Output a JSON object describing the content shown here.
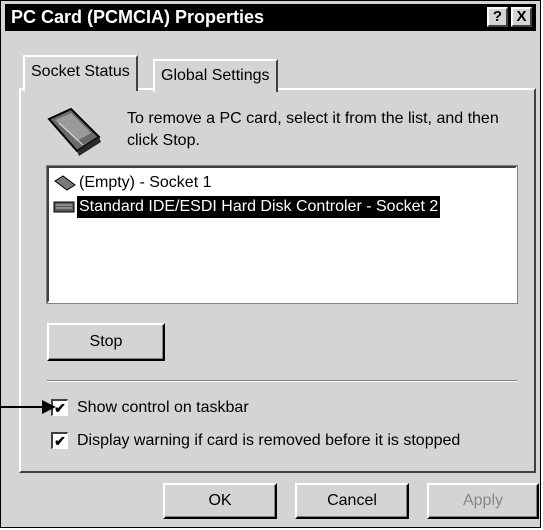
{
  "window": {
    "title": "PC Card (PCMCIA) Properties",
    "help_button": "?",
    "close_button": "X"
  },
  "tabs": [
    {
      "label": "Socket Status",
      "active": true
    },
    {
      "label": "Global Settings",
      "active": false
    }
  ],
  "info": {
    "text": "To remove a PC card, select it from the list, and then click Stop."
  },
  "socket_list": [
    {
      "label": "(Empty) - Socket 1",
      "selected": false,
      "icon": "pc-card-icon"
    },
    {
      "label": "Standard IDE/ESDI Hard Disk Controler - Socket 2",
      "selected": true,
      "icon": "disk-controller-icon"
    }
  ],
  "stop_button": {
    "label": "Stop"
  },
  "options": [
    {
      "label": "Show control on taskbar",
      "checked": true
    },
    {
      "label": "Display warning if card is removed before it is stopped",
      "checked": true
    }
  ],
  "footer": {
    "ok": "OK",
    "cancel": "Cancel",
    "apply": "Apply",
    "apply_disabled": true
  },
  "colors": {
    "face": "#d4d4d4",
    "titlebar": "#000000",
    "selection": "#000000"
  }
}
